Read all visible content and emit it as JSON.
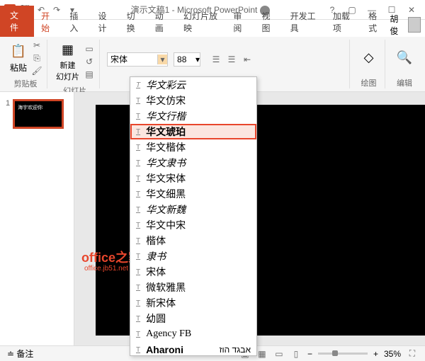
{
  "titlebar": {
    "title": "演示文稿1 - Microsoft PowerPoint"
  },
  "tabs": {
    "file": "文件",
    "home": "开始",
    "insert": "插入",
    "design": "设计",
    "transitions": "切换",
    "animations": "动画",
    "slideshow": "幻灯片放映",
    "review": "审阅",
    "view": "视图",
    "developer": "开发工具",
    "addins": "加载项",
    "format": "格式",
    "username": "胡俊"
  },
  "ribbon": {
    "clipboard": {
      "label": "剪贴板",
      "paste": "粘贴"
    },
    "slides": {
      "label": "幻灯片",
      "new": "新建\n幻灯片"
    },
    "font": {
      "name": "宋体",
      "size": "88"
    },
    "drawing": {
      "label": "绘图"
    },
    "editing": {
      "label": "编辑"
    }
  },
  "fontlist": [
    "华文仿宋",
    "华文行楷",
    "华文琥珀",
    "华文楷体",
    "华文隶书",
    "华文宋体",
    "华文细黑",
    "华文新魏",
    "华文中宋",
    "楷体",
    "隶书",
    "宋体",
    "微软雅黑",
    "新宋体",
    "幼圆",
    "Agency FB",
    "Aharoni"
  ],
  "fontlist_cut": "华文彩云",
  "fontlist_rtl": "אבגד הוז",
  "slide_thumb": {
    "num": "1",
    "text": "海宇欢迎你"
  },
  "watermark": {
    "main": "office之家",
    "sub": "office.jb51.net"
  },
  "status": {
    "notes": "备注",
    "zoom": "35%"
  }
}
